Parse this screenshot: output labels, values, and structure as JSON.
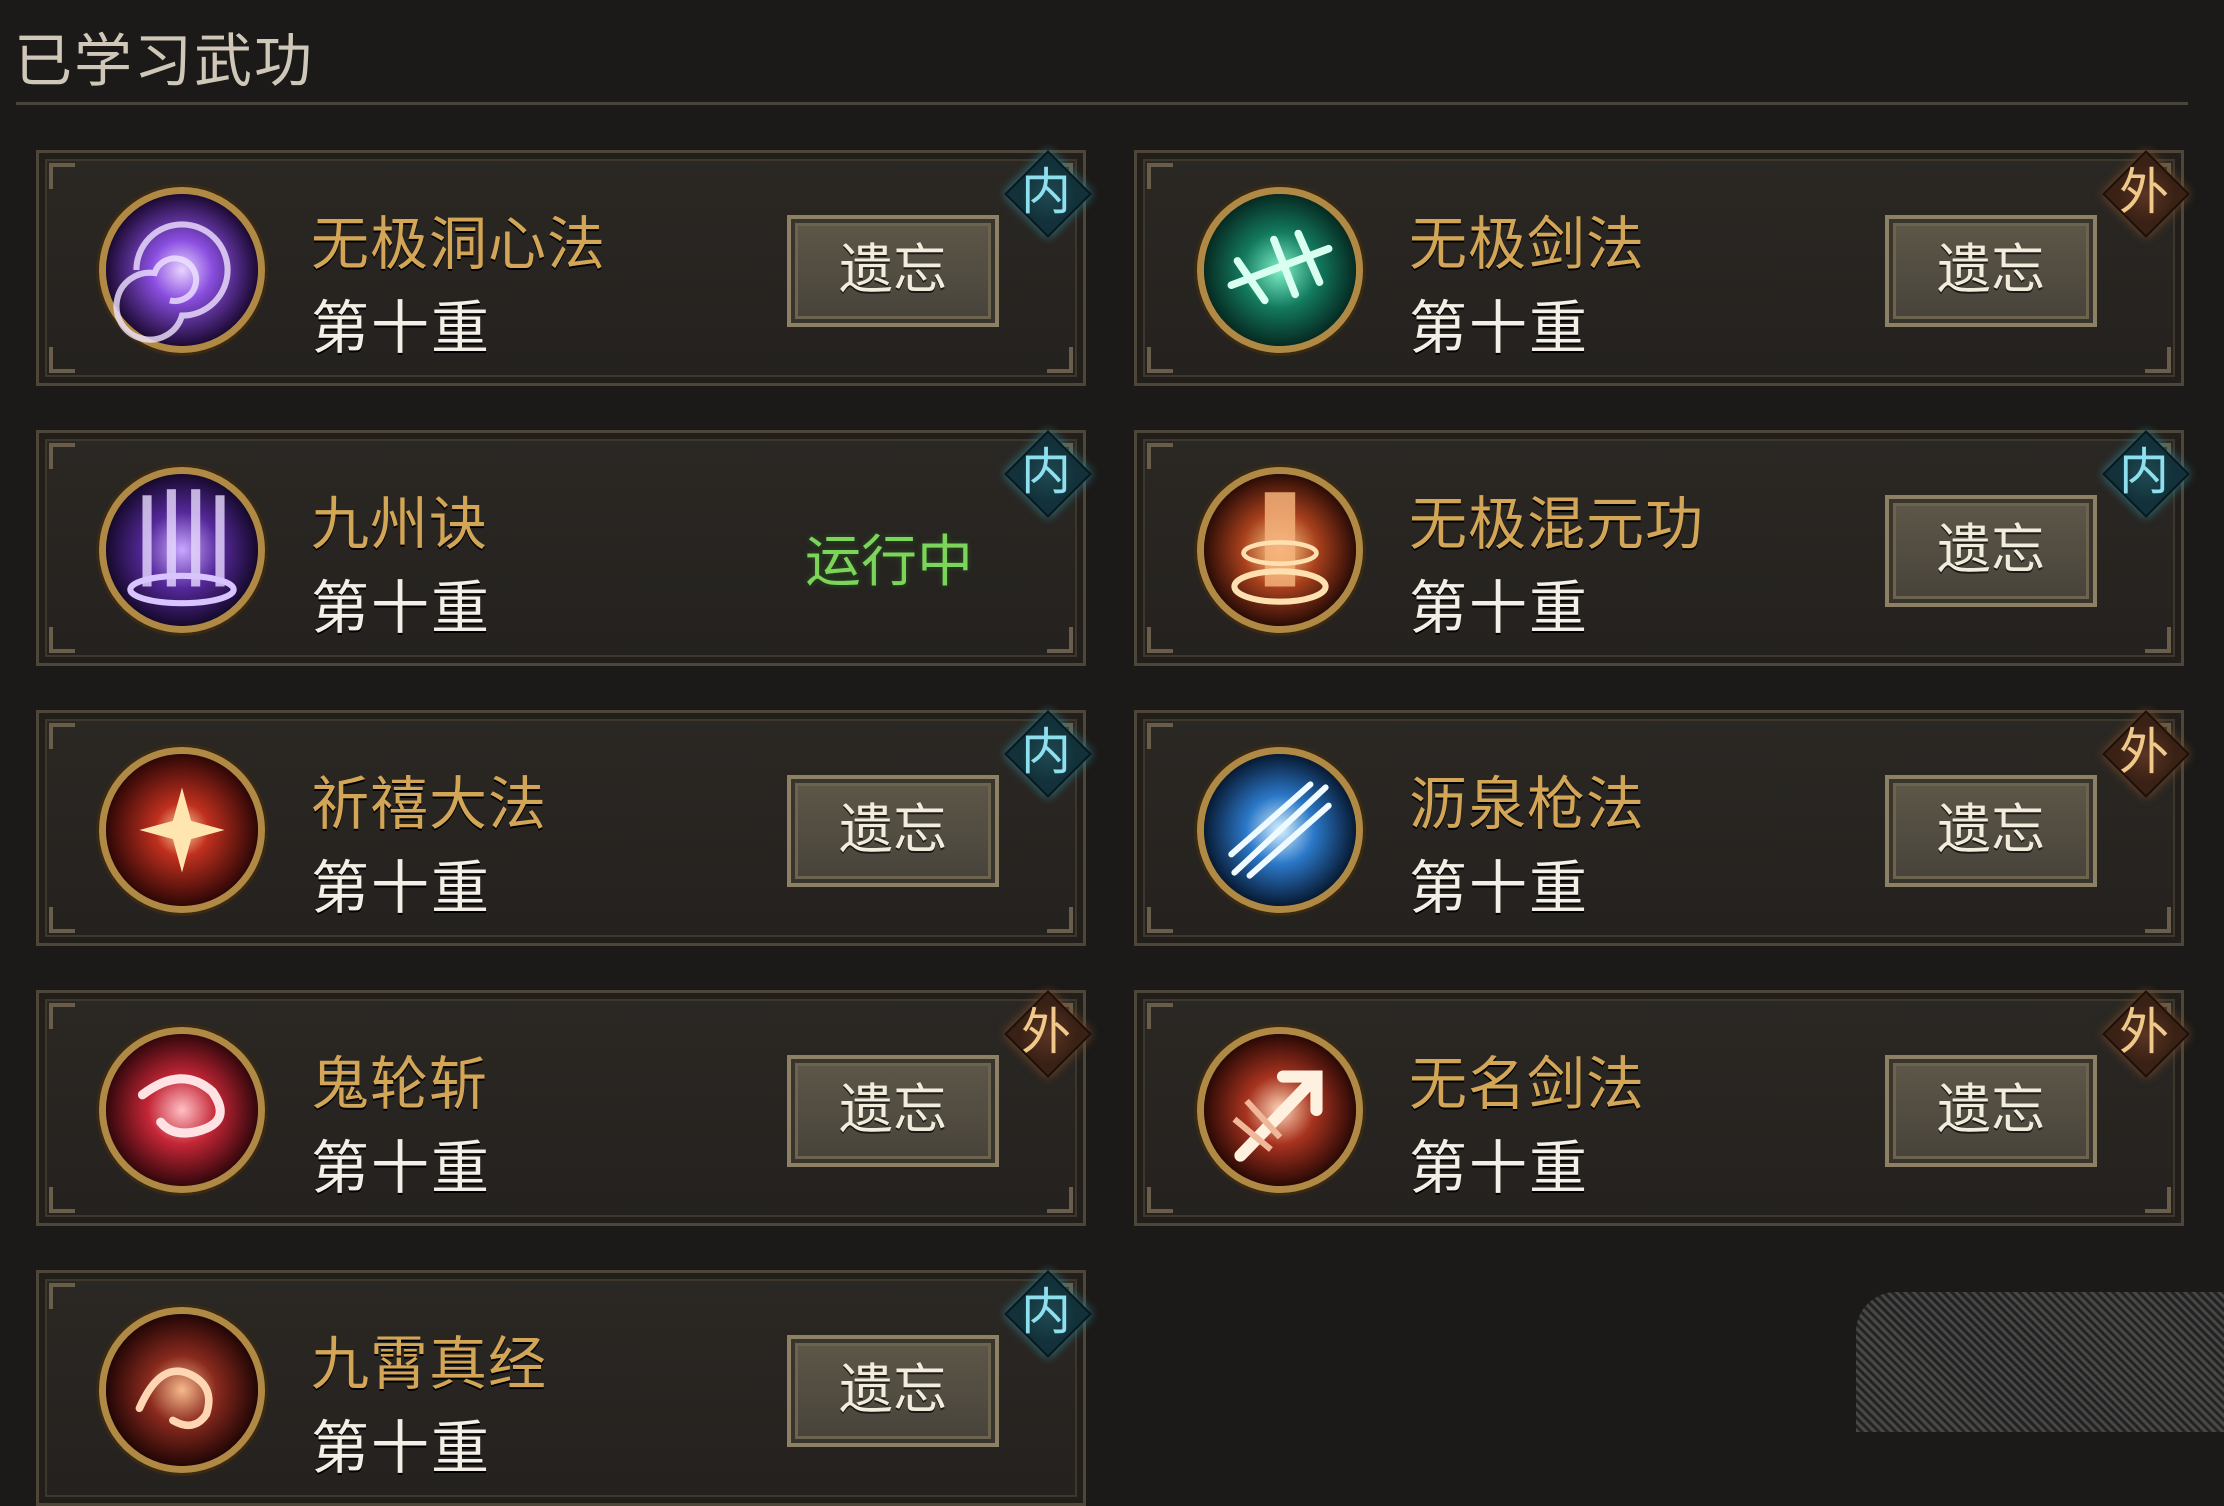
{
  "panel": {
    "title": "已学习武功"
  },
  "skills": [
    {
      "name": "无极洞心法",
      "level": "第十重",
      "badge": "内",
      "badge_kind": "inner",
      "action": "遗忘",
      "icon": "purple-vortex-icon",
      "accent": "#7b3fd0"
    },
    {
      "name": "无极剑法",
      "level": "第十重",
      "badge": "外",
      "badge_kind": "outer",
      "action": "遗忘",
      "icon": "green-sword-icon",
      "accent": "#1fae8a"
    },
    {
      "name": "九州诀",
      "level": "第十重",
      "badge": "内",
      "badge_kind": "inner",
      "status": "运行中",
      "icon": "purple-pillars-icon",
      "accent": "#6a3ab0"
    },
    {
      "name": "无极混元功",
      "level": "第十重",
      "badge": "内",
      "badge_kind": "inner",
      "action": "遗忘",
      "icon": "fire-pillar-icon",
      "accent": "#c8552a"
    },
    {
      "name": "祈禧大法",
      "level": "第十重",
      "badge": "内",
      "badge_kind": "inner",
      "action": "遗忘",
      "icon": "red-star-icon",
      "accent": "#b32a1e"
    },
    {
      "name": "沥泉枪法",
      "level": "第十重",
      "badge": "外",
      "badge_kind": "outer",
      "action": "遗忘",
      "icon": "blue-spear-icon",
      "accent": "#2f8ad8"
    },
    {
      "name": "鬼轮斩",
      "level": "第十重",
      "badge": "外",
      "badge_kind": "outer",
      "action": "遗忘",
      "icon": "red-swirl-icon",
      "accent": "#c4283a"
    },
    {
      "name": "无名剑法",
      "level": "第十重",
      "badge": "外",
      "badge_kind": "outer",
      "action": "遗忘",
      "icon": "slash-arrow-icon",
      "accent": "#b0392a"
    },
    {
      "name": "九霄真经",
      "level": "第十重",
      "badge": "内",
      "badge_kind": "inner",
      "action": "遗忘",
      "icon": "crimson-dragon-icon",
      "accent": "#8a2a1e"
    }
  ]
}
